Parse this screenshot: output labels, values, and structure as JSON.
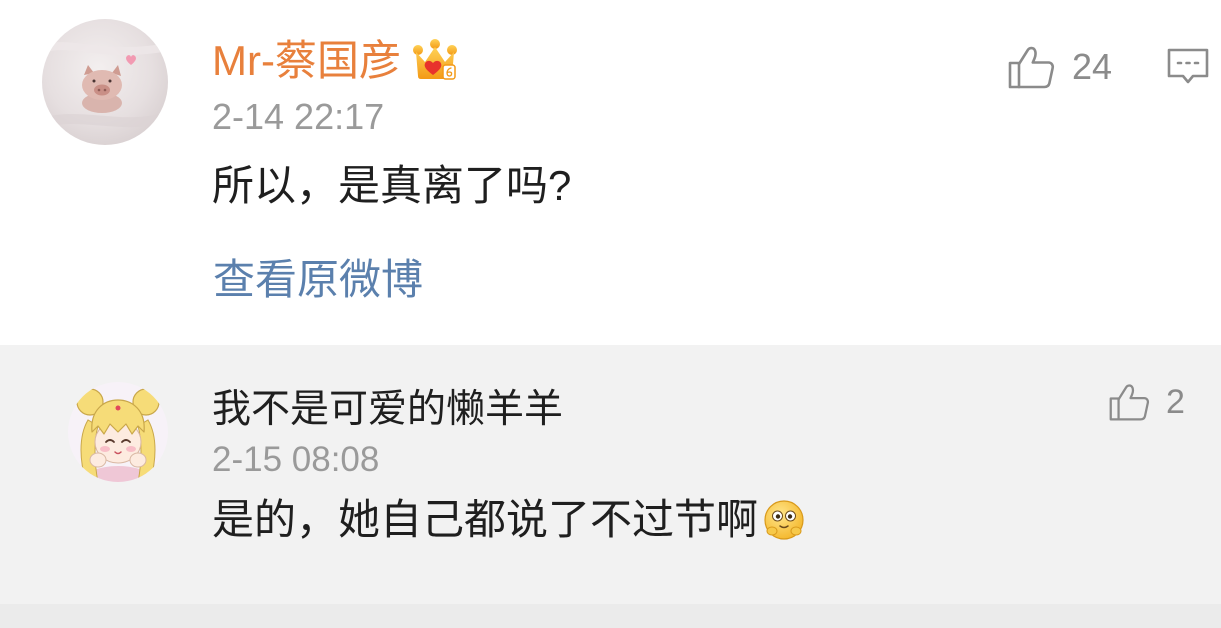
{
  "colors": {
    "username_vip": "#e8803c",
    "timestamp": "#9a9a9a",
    "text": "#1f1f1f",
    "link": "#5b80ad",
    "icon": "#8b8b8b",
    "page_bg": "#ffffff",
    "reply_bg": "#f2f2f2",
    "strip_bg": "#ebebeb",
    "vip_crown": "#f5a623"
  },
  "comment": {
    "avatar_icon": "pig-plush-avatar",
    "username": "Mr-蔡国彦",
    "badge_icon": "vip-crown-icon",
    "timestamp": "2-14 22:17",
    "text": "所以，是真离了吗?",
    "view_original_label": "查看原微博",
    "like_icon": "thumbs-up-icon",
    "like_count": "24",
    "reply_icon": "comment-icon"
  },
  "reply": {
    "avatar_icon": "cartoon-girl-avatar",
    "username": "我不是可爱的懒羊羊",
    "timestamp": "2-15 08:08",
    "text": "是的，她自己都说了不过节啊",
    "emoji_icon": "wide-eyed-face-emoji",
    "like_icon": "thumbs-up-icon",
    "like_count": "2"
  }
}
